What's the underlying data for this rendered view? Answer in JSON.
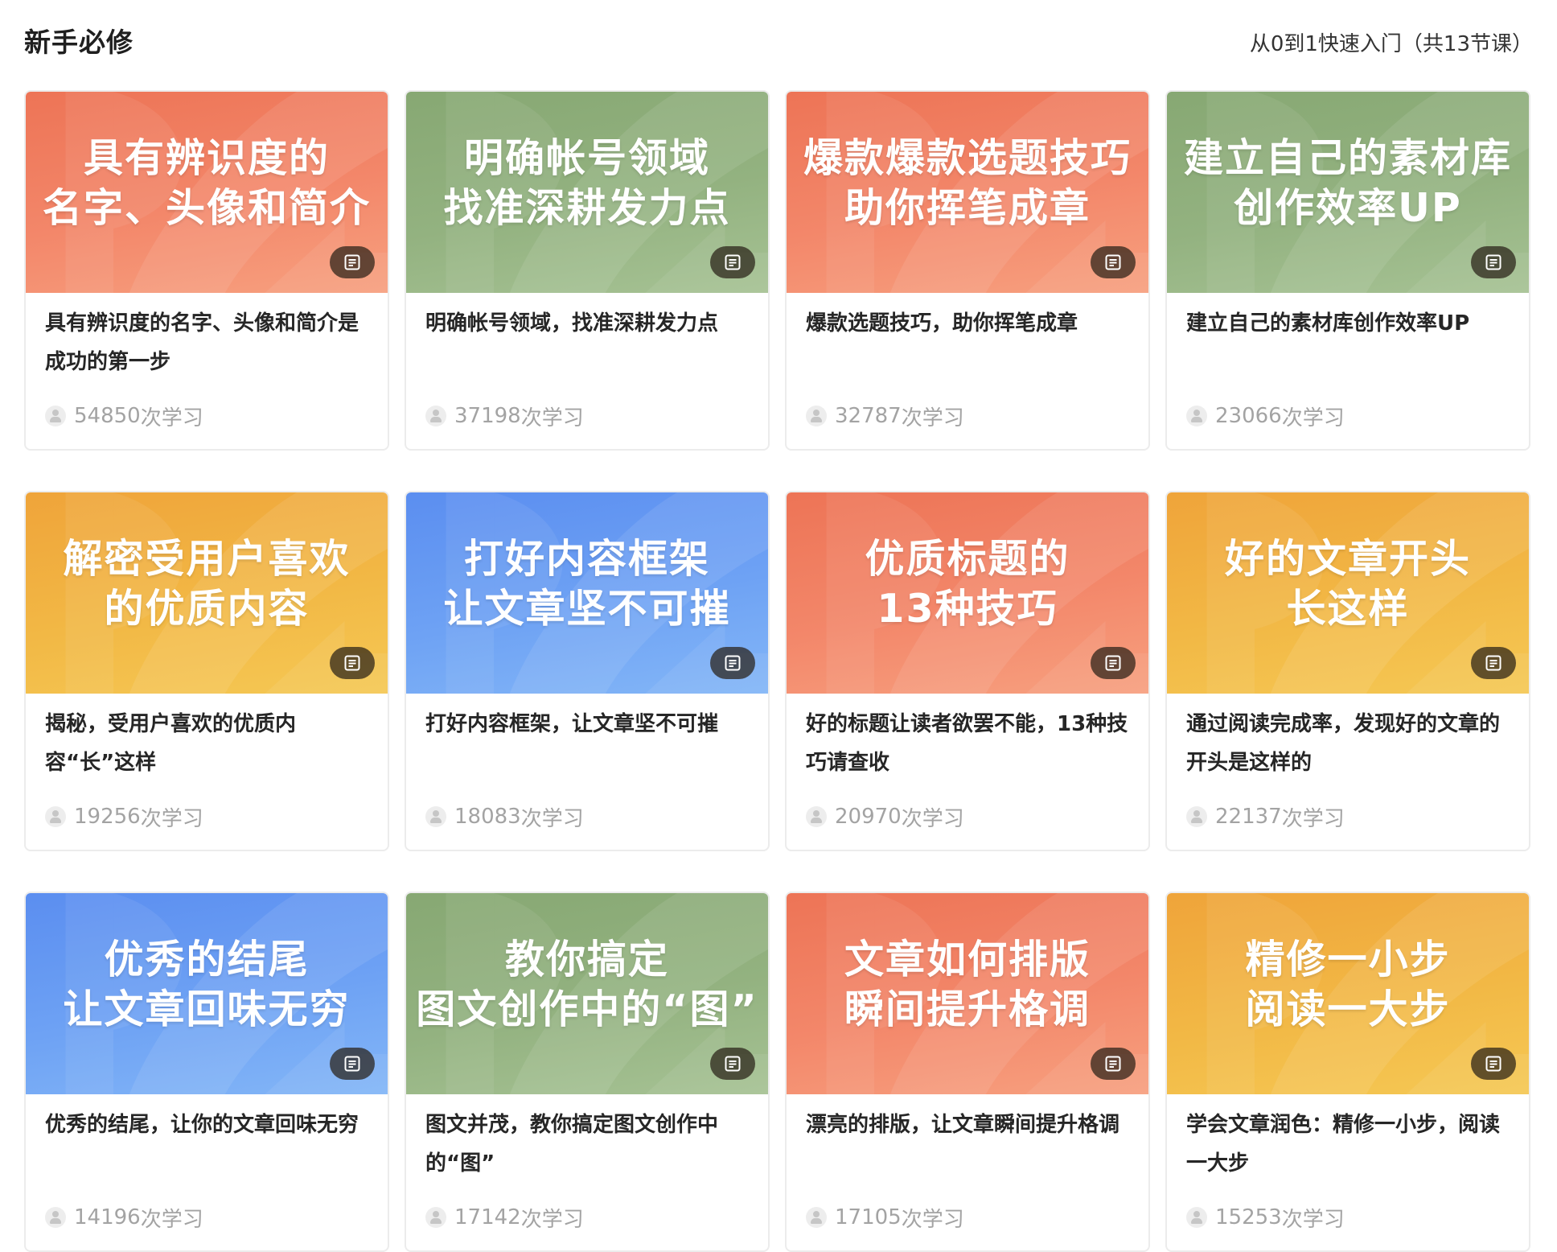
{
  "section": {
    "title": "新手必修",
    "subtitle": "从0到1快速入门（共13节课）"
  },
  "icons": {
    "badge": "document-icon",
    "learners": "user-icon"
  },
  "colors": {
    "orange": "#ef7b5b",
    "green": "#8fae7c",
    "yellow": "#f1b041",
    "blue": "#6398f2"
  },
  "courses": [
    {
      "banner_lines": [
        "具有辨识度的",
        "名字、头像和简介"
      ],
      "banner_color": "orange",
      "description": "具有辨识度的名字、头像和简介是成功的第一步",
      "learn_count": "54850",
      "learn_suffix": "次学习"
    },
    {
      "banner_lines": [
        "明确帐号领域",
        "找准深耕发力点"
      ],
      "banner_color": "green",
      "description": "明确帐号领域，找准深耕发力点",
      "learn_count": "37198",
      "learn_suffix": "次学习"
    },
    {
      "banner_lines": [
        "爆款爆款选题技巧",
        "助你挥笔成章"
      ],
      "banner_color": "orange",
      "description": "爆款选题技巧，助你挥笔成章",
      "learn_count": "32787",
      "learn_suffix": "次学习"
    },
    {
      "banner_lines": [
        "建立自己的素材库",
        "创作效率UP"
      ],
      "banner_color": "green",
      "description": "建立自己的素材库创作效率UP",
      "learn_count": "23066",
      "learn_suffix": "次学习"
    },
    {
      "banner_lines": [
        "解密受用户喜欢",
        "的优质内容"
      ],
      "banner_color": "yellow",
      "description": "揭秘，受用户喜欢的优质内容“长”这样",
      "learn_count": "19256",
      "learn_suffix": "次学习"
    },
    {
      "banner_lines": [
        "打好内容框架",
        "让文章坚不可摧"
      ],
      "banner_color": "blue",
      "description": "打好内容框架，让文章坚不可摧",
      "learn_count": "18083",
      "learn_suffix": "次学习"
    },
    {
      "banner_lines": [
        "优质标题的",
        "13种技巧"
      ],
      "banner_color": "orange",
      "description": "好的标题让读者欲罢不能，13种技巧请查收",
      "learn_count": "20970",
      "learn_suffix": "次学习"
    },
    {
      "banner_lines": [
        "好的文章开头",
        "长这样"
      ],
      "banner_color": "yellow",
      "description": "通过阅读完成率，发现好的文章的开头是这样的",
      "learn_count": "22137",
      "learn_suffix": "次学习"
    },
    {
      "banner_lines": [
        "优秀的结尾",
        "让文章回味无穷"
      ],
      "banner_color": "blue",
      "description": "优秀的结尾，让你的文章回味无穷",
      "learn_count": "14196",
      "learn_suffix": "次学习"
    },
    {
      "banner_lines": [
        "教你搞定",
        "图文创作中的“图”"
      ],
      "banner_color": "green",
      "description": "图文并茂，教你搞定图文创作中的“图”",
      "learn_count": "17142",
      "learn_suffix": "次学习"
    },
    {
      "banner_lines": [
        "文章如何排版",
        "瞬间提升格调"
      ],
      "banner_color": "orange",
      "description": "漂亮的排版，让文章瞬间提升格调",
      "learn_count": "17105",
      "learn_suffix": "次学习"
    },
    {
      "banner_lines": [
        "精修一小步",
        "阅读一大步"
      ],
      "banner_color": "yellow",
      "description": "学会文章润色：精修一小步，阅读一大步",
      "learn_count": "15253",
      "learn_suffix": "次学习"
    }
  ]
}
